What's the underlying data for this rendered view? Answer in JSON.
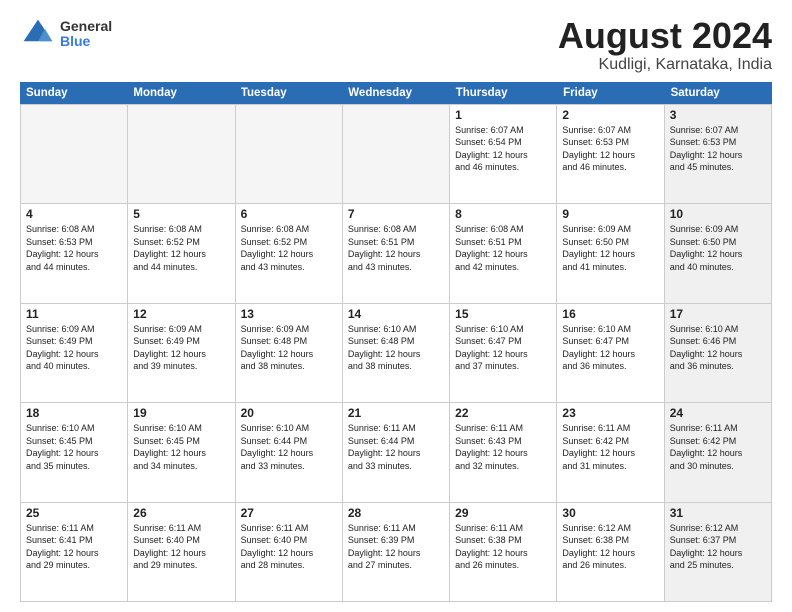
{
  "logo": {
    "general": "General",
    "blue": "Blue"
  },
  "title": "August 2024",
  "subtitle": "Kudligi, Karnataka, India",
  "header_days": [
    "Sunday",
    "Monday",
    "Tuesday",
    "Wednesday",
    "Thursday",
    "Friday",
    "Saturday"
  ],
  "weeks": [
    [
      {
        "day": "",
        "info": "",
        "shaded": true
      },
      {
        "day": "",
        "info": "",
        "shaded": true
      },
      {
        "day": "",
        "info": "",
        "shaded": true
      },
      {
        "day": "",
        "info": "",
        "shaded": true
      },
      {
        "day": "1",
        "info": "Sunrise: 6:07 AM\nSunset: 6:54 PM\nDaylight: 12 hours\nand 46 minutes.",
        "shaded": false
      },
      {
        "day": "2",
        "info": "Sunrise: 6:07 AM\nSunset: 6:53 PM\nDaylight: 12 hours\nand 46 minutes.",
        "shaded": false
      },
      {
        "day": "3",
        "info": "Sunrise: 6:07 AM\nSunset: 6:53 PM\nDaylight: 12 hours\nand 45 minutes.",
        "shaded": true
      }
    ],
    [
      {
        "day": "4",
        "info": "Sunrise: 6:08 AM\nSunset: 6:53 PM\nDaylight: 12 hours\nand 44 minutes.",
        "shaded": false
      },
      {
        "day": "5",
        "info": "Sunrise: 6:08 AM\nSunset: 6:52 PM\nDaylight: 12 hours\nand 44 minutes.",
        "shaded": false
      },
      {
        "day": "6",
        "info": "Sunrise: 6:08 AM\nSunset: 6:52 PM\nDaylight: 12 hours\nand 43 minutes.",
        "shaded": false
      },
      {
        "day": "7",
        "info": "Sunrise: 6:08 AM\nSunset: 6:51 PM\nDaylight: 12 hours\nand 43 minutes.",
        "shaded": false
      },
      {
        "day": "8",
        "info": "Sunrise: 6:08 AM\nSunset: 6:51 PM\nDaylight: 12 hours\nand 42 minutes.",
        "shaded": false
      },
      {
        "day": "9",
        "info": "Sunrise: 6:09 AM\nSunset: 6:50 PM\nDaylight: 12 hours\nand 41 minutes.",
        "shaded": false
      },
      {
        "day": "10",
        "info": "Sunrise: 6:09 AM\nSunset: 6:50 PM\nDaylight: 12 hours\nand 40 minutes.",
        "shaded": true
      }
    ],
    [
      {
        "day": "11",
        "info": "Sunrise: 6:09 AM\nSunset: 6:49 PM\nDaylight: 12 hours\nand 40 minutes.",
        "shaded": false
      },
      {
        "day": "12",
        "info": "Sunrise: 6:09 AM\nSunset: 6:49 PM\nDaylight: 12 hours\nand 39 minutes.",
        "shaded": false
      },
      {
        "day": "13",
        "info": "Sunrise: 6:09 AM\nSunset: 6:48 PM\nDaylight: 12 hours\nand 38 minutes.",
        "shaded": false
      },
      {
        "day": "14",
        "info": "Sunrise: 6:10 AM\nSunset: 6:48 PM\nDaylight: 12 hours\nand 38 minutes.",
        "shaded": false
      },
      {
        "day": "15",
        "info": "Sunrise: 6:10 AM\nSunset: 6:47 PM\nDaylight: 12 hours\nand 37 minutes.",
        "shaded": false
      },
      {
        "day": "16",
        "info": "Sunrise: 6:10 AM\nSunset: 6:47 PM\nDaylight: 12 hours\nand 36 minutes.",
        "shaded": false
      },
      {
        "day": "17",
        "info": "Sunrise: 6:10 AM\nSunset: 6:46 PM\nDaylight: 12 hours\nand 36 minutes.",
        "shaded": true
      }
    ],
    [
      {
        "day": "18",
        "info": "Sunrise: 6:10 AM\nSunset: 6:45 PM\nDaylight: 12 hours\nand 35 minutes.",
        "shaded": false
      },
      {
        "day": "19",
        "info": "Sunrise: 6:10 AM\nSunset: 6:45 PM\nDaylight: 12 hours\nand 34 minutes.",
        "shaded": false
      },
      {
        "day": "20",
        "info": "Sunrise: 6:10 AM\nSunset: 6:44 PM\nDaylight: 12 hours\nand 33 minutes.",
        "shaded": false
      },
      {
        "day": "21",
        "info": "Sunrise: 6:11 AM\nSunset: 6:44 PM\nDaylight: 12 hours\nand 33 minutes.",
        "shaded": false
      },
      {
        "day": "22",
        "info": "Sunrise: 6:11 AM\nSunset: 6:43 PM\nDaylight: 12 hours\nand 32 minutes.",
        "shaded": false
      },
      {
        "day": "23",
        "info": "Sunrise: 6:11 AM\nSunset: 6:42 PM\nDaylight: 12 hours\nand 31 minutes.",
        "shaded": false
      },
      {
        "day": "24",
        "info": "Sunrise: 6:11 AM\nSunset: 6:42 PM\nDaylight: 12 hours\nand 30 minutes.",
        "shaded": true
      }
    ],
    [
      {
        "day": "25",
        "info": "Sunrise: 6:11 AM\nSunset: 6:41 PM\nDaylight: 12 hours\nand 29 minutes.",
        "shaded": false
      },
      {
        "day": "26",
        "info": "Sunrise: 6:11 AM\nSunset: 6:40 PM\nDaylight: 12 hours\nand 29 minutes.",
        "shaded": false
      },
      {
        "day": "27",
        "info": "Sunrise: 6:11 AM\nSunset: 6:40 PM\nDaylight: 12 hours\nand 28 minutes.",
        "shaded": false
      },
      {
        "day": "28",
        "info": "Sunrise: 6:11 AM\nSunset: 6:39 PM\nDaylight: 12 hours\nand 27 minutes.",
        "shaded": false
      },
      {
        "day": "29",
        "info": "Sunrise: 6:11 AM\nSunset: 6:38 PM\nDaylight: 12 hours\nand 26 minutes.",
        "shaded": false
      },
      {
        "day": "30",
        "info": "Sunrise: 6:12 AM\nSunset: 6:38 PM\nDaylight: 12 hours\nand 26 minutes.",
        "shaded": false
      },
      {
        "day": "31",
        "info": "Sunrise: 6:12 AM\nSunset: 6:37 PM\nDaylight: 12 hours\nand 25 minutes.",
        "shaded": true
      }
    ]
  ]
}
